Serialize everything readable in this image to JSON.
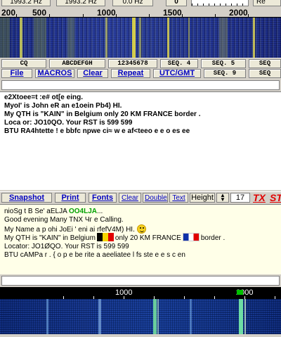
{
  "freq": {
    "box1": "1993.2 Hz",
    "box2": "1993.2 Hz",
    "box3": "0.0 Hz",
    "box4": "0",
    "re_button": "Re"
  },
  "scale_top": [
    "200",
    "500",
    "1000",
    "1500",
    "2000"
  ],
  "macros": {
    "row1": [
      "CQ",
      "ABCDEFGH",
      "12345678",
      "SEQ. 4",
      "SEQ. 5",
      "SEQ"
    ],
    "row2": [
      "File",
      "MACROS",
      "Clear",
      "Repeat",
      "UTC/GMT",
      "SEQ. 9",
      "SEQ"
    ]
  },
  "tx": {
    "lines": [
      "e2Xtoee=t :e# ot[e eing.",
      "MyoI' is John eR an e1oein Pb4)  HI.",
      "My QTH is \"KAIN\" in Belgium  only  20 KM FRANCE border .",
      "Loca or: JO10QO. Your RST is 599 599",
      "BTU  RA4htette !  e bbfc  npwe ci≈  w e af<teeo e e o es ee"
    ]
  },
  "toolbar": {
    "snapshot": "Snapshot",
    "print": "Print",
    "fonts": "Fonts",
    "clear": "Clear",
    "double": "Double",
    "text": "Text",
    "height_label": "Height",
    "height_value": "17",
    "tx": "TX",
    "st": "ST"
  },
  "rx": {
    "line1_pre": "nioSg t B  Se'  aELJA ",
    "line1_call": "OO4LJA",
    "line1_post": "...",
    "line2": "Good evening  Many TNX Чг e Calling.",
    "line3": "My Name   a p ohi JoEi ' eni  ai rfefV4M)  HI.",
    "line4_a": "My QTH is \"KAIN\" in Belgium",
    "line4_b": "only  20 KM FRANCE",
    "line4_c": "border .",
    "line5": "Locator: JO1ØQO. Your RST is 599 599",
    "line6": "BTU  cAMPa   r  . { o p  e be rite  a aeeliatee l fs ste  e e s  c en"
  },
  "scale_bottom": [
    "1000",
    "2000"
  ],
  "colors": {
    "accent": "#0000c0",
    "tx_red": "#e00000",
    "callsign_green": "#00a000"
  }
}
